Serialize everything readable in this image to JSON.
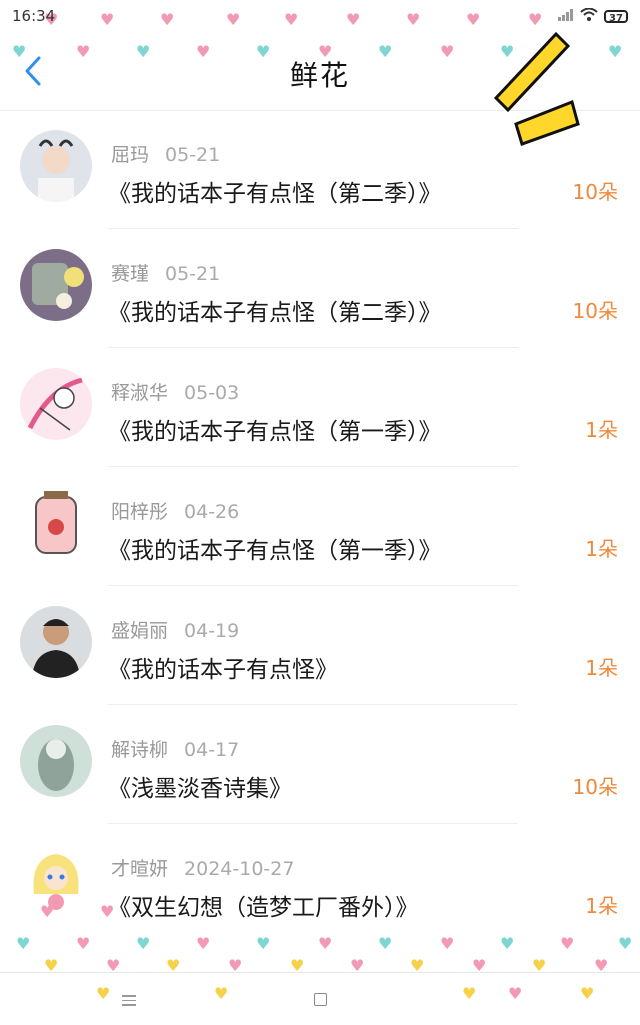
{
  "status_bar": {
    "time": "16:34",
    "battery": "37"
  },
  "header": {
    "title": "鲜花"
  },
  "colors": {
    "accent_orange": "#f0883a",
    "back_blue": "#2f8ff0",
    "deco_yellow": "#ffd72a"
  },
  "items": [
    {
      "name": "屈玛",
      "date": "05-21",
      "title": "《我的话本子有点怪（第二季）》",
      "count": "10朵"
    },
    {
      "name": "赛瑾",
      "date": "05-21",
      "title": "《我的话本子有点怪（第二季）》",
      "count": "10朵"
    },
    {
      "name": "释淑华",
      "date": "05-03",
      "title": "《我的话本子有点怪（第一季）》",
      "count": "1朵"
    },
    {
      "name": "阳梓彤",
      "date": "04-26",
      "title": "《我的话本子有点怪（第一季）》",
      "count": "1朵"
    },
    {
      "name": "盛娟丽",
      "date": "04-19",
      "title": "《我的话本子有点怪》",
      "count": "1朵"
    },
    {
      "name": "解诗柳",
      "date": "04-17",
      "title": "《浅墨淡香诗集》",
      "count": "10朵"
    },
    {
      "name": "才暄妍",
      "date": "2024-10-27",
      "title": "《双生幻想（造梦工厂番外）》",
      "count": "1朵"
    }
  ]
}
